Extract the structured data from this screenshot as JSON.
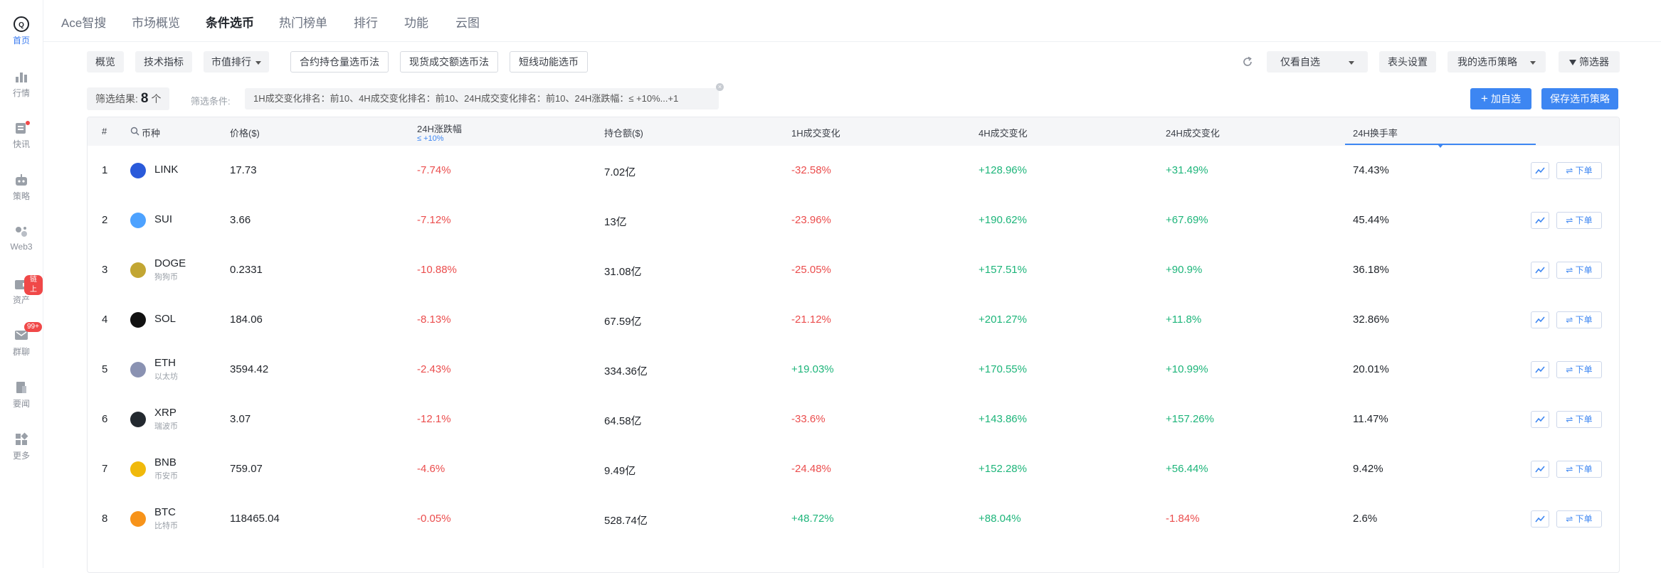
{
  "sidebar": {
    "items": [
      {
        "label": "首页",
        "icon": "home-logo-icon",
        "active": true
      },
      {
        "label": "行情",
        "icon": "bar-chart-icon"
      },
      {
        "label": "快讯",
        "icon": "news-icon"
      },
      {
        "label": "策略",
        "icon": "robot-icon"
      },
      {
        "label": "Web3",
        "icon": "web3-icon"
      },
      {
        "label": "资产",
        "icon": "wallet-icon",
        "badge": "链上"
      },
      {
        "label": "群聊",
        "icon": "chat-icon",
        "badge": "99+"
      },
      {
        "label": "要闻",
        "icon": "document-icon"
      },
      {
        "label": "更多",
        "icon": "grid-icon"
      }
    ]
  },
  "topnav": {
    "tabs": [
      "Ace智搜",
      "市场概览",
      "条件选币",
      "热门榜单",
      "排行",
      "功能",
      "云图"
    ],
    "active_index": 2
  },
  "toolbar": {
    "overview": "概览",
    "tech": "技术指标",
    "mcap_rank": "市值排行",
    "contract_method": "合约持仓量选币法",
    "spot_method": "现货成交额选币法",
    "short_method": "短线动能选币",
    "watchlist_only": "仅看自选",
    "header_settings": "表头设置",
    "my_strategy": "我的选币策略",
    "filter": "筛选器",
    "add_watch": "加自选",
    "save_strategy": "保存选币策略"
  },
  "result": {
    "label": "筛选结果:",
    "count": "8",
    "unit": "个",
    "cond_label": "筛选条件:",
    "conditions": "1H成交变化排名：前10、4H成交变化排名：前10、24H成交变化排名：前10、24H涨跌幅：≤ +10%...+1"
  },
  "table": {
    "headers": {
      "index": "#",
      "coin": "币种",
      "price": "价格($)",
      "change24h": "24H涨跌幅",
      "change24h_sub": "≤ +10%",
      "oi": "持仓额($)",
      "vol1h": "1H成交变化",
      "vol4h": "4H成交变化",
      "vol24h": "24H成交变化",
      "turnover": "24H换手率"
    },
    "order_label": "⇌ 下单",
    "rows": [
      {
        "index": "1",
        "symbol": "LINK",
        "cn": "",
        "price": "17.73",
        "change24h": "-7.74%",
        "oi": "7.02亿",
        "vol1h": "-32.58%",
        "vol4h": "+128.96%",
        "vol24h": "+31.49%",
        "turnover": "74.43%",
        "color": "#2a5ada"
      },
      {
        "index": "2",
        "symbol": "SUI",
        "cn": "",
        "price": "3.66",
        "change24h": "-7.12%",
        "oi": "13亿",
        "vol1h": "-23.96%",
        "vol4h": "+190.62%",
        "vol24h": "+67.69%",
        "turnover": "45.44%",
        "color": "#4da2ff"
      },
      {
        "index": "3",
        "symbol": "DOGE",
        "cn": "狗狗币",
        "price": "0.2331",
        "change24h": "-10.88%",
        "oi": "31.08亿",
        "vol1h": "-25.05%",
        "vol4h": "+157.51%",
        "vol24h": "+90.9%",
        "turnover": "36.18%",
        "color": "#c2a633"
      },
      {
        "index": "4",
        "symbol": "SOL",
        "cn": "",
        "price": "184.06",
        "change24h": "-8.13%",
        "oi": "67.59亿",
        "vol1h": "-21.12%",
        "vol4h": "+201.27%",
        "vol24h": "+11.8%",
        "turnover": "32.86%",
        "color": "#111111"
      },
      {
        "index": "5",
        "symbol": "ETH",
        "cn": "以太坊",
        "price": "3594.42",
        "change24h": "-2.43%",
        "oi": "334.36亿",
        "vol1h": "+19.03%",
        "vol4h": "+170.55%",
        "vol24h": "+10.99%",
        "turnover": "20.01%",
        "color": "#8a92b2"
      },
      {
        "index": "6",
        "symbol": "XRP",
        "cn": "瑞波币",
        "price": "3.07",
        "change24h": "-12.1%",
        "oi": "64.58亿",
        "vol1h": "-33.6%",
        "vol4h": "+143.86%",
        "vol24h": "+157.26%",
        "turnover": "11.47%",
        "color": "#23292f"
      },
      {
        "index": "7",
        "symbol": "BNB",
        "cn": "币安币",
        "price": "759.07",
        "change24h": "-4.6%",
        "oi": "9.49亿",
        "vol1h": "-24.48%",
        "vol4h": "+152.28%",
        "vol24h": "+56.44%",
        "turnover": "9.42%",
        "color": "#f0b90b"
      },
      {
        "index": "8",
        "symbol": "BTC",
        "cn": "比特币",
        "price": "118465.04",
        "change24h": "-0.05%",
        "oi": "528.74亿",
        "vol1h": "+48.72%",
        "vol4h": "+88.04%",
        "vol24h": "-1.84%",
        "turnover": "2.6%",
        "color": "#f7931a"
      }
    ]
  }
}
